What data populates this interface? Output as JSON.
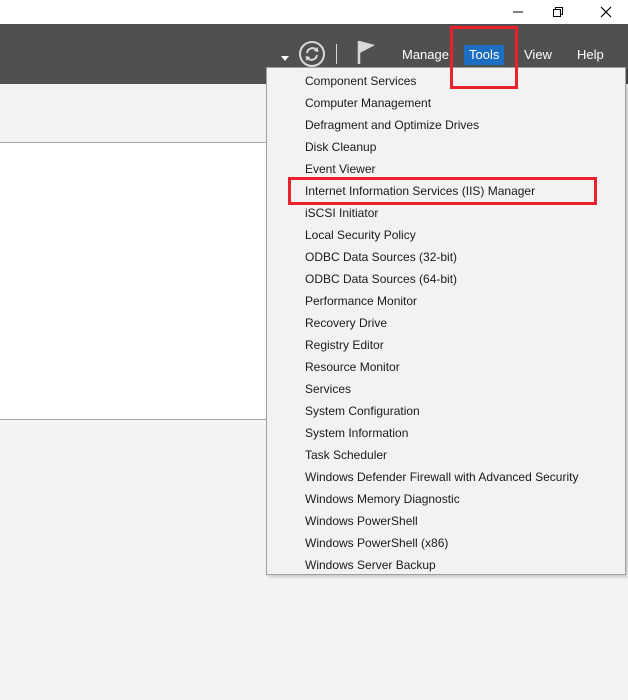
{
  "window_controls": {
    "minimize": "—",
    "maximize": "❐",
    "close": "✕"
  },
  "menubar": {
    "items": [
      {
        "label": "Manage"
      },
      {
        "label": "Tools"
      },
      {
        "label": "View"
      },
      {
        "label": "Help"
      }
    ],
    "active_index": 1
  },
  "tools_menu": {
    "items": [
      {
        "label": "Component Services"
      },
      {
        "label": "Computer Management"
      },
      {
        "label": "Defragment and Optimize Drives"
      },
      {
        "label": "Disk Cleanup"
      },
      {
        "label": "Event Viewer"
      },
      {
        "label": "Internet Information Services (IIS) Manager"
      },
      {
        "label": "iSCSI Initiator"
      },
      {
        "label": "Local Security Policy"
      },
      {
        "label": "ODBC Data Sources (32-bit)"
      },
      {
        "label": "ODBC Data Sources (64-bit)"
      },
      {
        "label": "Performance Monitor"
      },
      {
        "label": "Recovery Drive"
      },
      {
        "label": "Registry Editor"
      },
      {
        "label": "Resource Monitor"
      },
      {
        "label": "Services"
      },
      {
        "label": "System Configuration"
      },
      {
        "label": "System Information"
      },
      {
        "label": "Task Scheduler"
      },
      {
        "label": "Windows Defender Firewall with Advanced Security"
      },
      {
        "label": "Windows Memory Diagnostic"
      },
      {
        "label": "Windows PowerShell"
      },
      {
        "label": "Windows PowerShell (x86)"
      },
      {
        "label": "Windows Server Backup"
      }
    ]
  },
  "colors": {
    "menubar_bg": "#505050",
    "active_menu": "#1b6ec2",
    "annotation_red": "#e8212a"
  },
  "icons": [
    "dropdown-arrow-icon",
    "refresh-icon",
    "flag-icon"
  ]
}
